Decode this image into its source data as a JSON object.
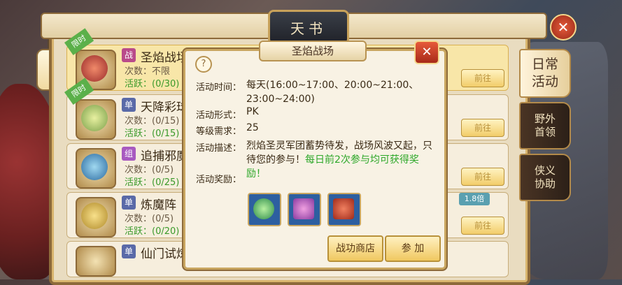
{
  "window": {
    "title": "天书"
  },
  "tabs": [
    {
      "label": "日常\n活动"
    },
    {
      "label": "野外\n首领"
    },
    {
      "label": "侠义\n协助"
    }
  ],
  "list": [
    {
      "ribbon": "限时",
      "tag": "战",
      "name": "圣焰战场",
      "count": "次数：不限",
      "active": "活跃：(0/30)",
      "button": "前往"
    },
    {
      "ribbon": "限时",
      "tag": "单",
      "name": "天降彩球",
      "count": "次数：(0/15)",
      "active": "活跃：(0/15)",
      "button": "前往"
    },
    {
      "ribbon": "",
      "tag": "组",
      "name": "追捕邪魔",
      "count": "次数：(0/5)",
      "active": "活跃：(0/25)",
      "button": "前往"
    },
    {
      "ribbon": "",
      "tag": "单",
      "name": "炼魔阵",
      "count": "次数：(0/5)",
      "active": "活跃：(0/20)",
      "button": "前往"
    },
    {
      "ribbon": "",
      "tag": "单",
      "name": "仙门试炼",
      "count": "",
      "active": "",
      "button": ""
    }
  ],
  "badge": "1.8倍",
  "popup": {
    "title": "圣焰战场",
    "help": "?",
    "time_label": "活动时间：",
    "time_value": "每天(16:00~17:00、20:00~21:00、23:00~24:00)",
    "form_label": "活动形式：",
    "form_value": "PK",
    "level_label": "等级需求：",
    "level_value": "25",
    "desc_label": "活动描述：",
    "desc_value": "烈焰圣灵军团蓄势待发，战场风波又起，只待您的参与！",
    "desc_highlight": "每日前2次参与均可获得奖励！",
    "reward_label": "活动奖励：",
    "shop_button": "战功商店",
    "join_button": "参 加"
  },
  "colors": {
    "accent": "#f0c860",
    "active_green": "#3a9a2a",
    "close_red": "#a82a18"
  }
}
